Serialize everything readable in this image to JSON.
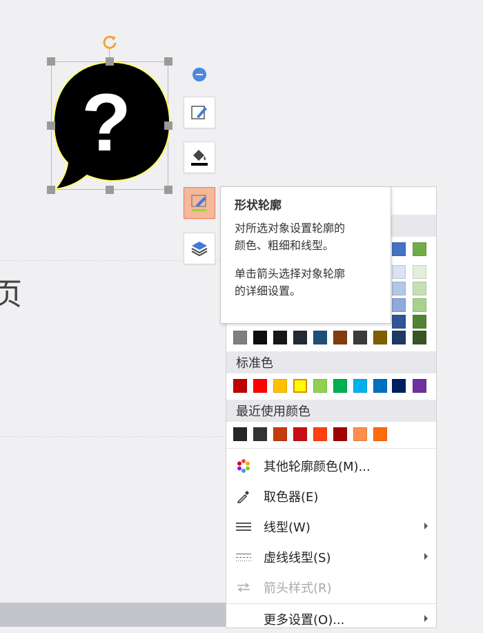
{
  "tooltip": {
    "title": "形状轮廓",
    "line1": "对所选对象设置轮廓的",
    "line2": "颜色、粗细和线型。",
    "line3": "单击箭头选择对象轮廓",
    "line4": "的详细设置。"
  },
  "slide": {
    "partial_text": "页"
  },
  "shape": {
    "glyph": "?"
  },
  "side_buttons": [
    {
      "name": "edit-shape",
      "icon": "pencil-square-icon"
    },
    {
      "name": "fill",
      "icon": "paint-bucket-icon"
    },
    {
      "name": "outline",
      "icon": "pen-outline-icon"
    },
    {
      "name": "layers",
      "icon": "layers-icon"
    }
  ],
  "outline_menu": {
    "theme_colors": {
      "top_row_partial": [
        "#4472c4",
        "#70ad47"
      ],
      "tint_rows_partial": [
        [
          "#dae3f3",
          "#e2efda"
        ],
        [
          "#b4c7e7",
          "#c5e0b4"
        ],
        [
          "#8faadc",
          "#a9d18e"
        ],
        [
          "#2f5597",
          "#548235"
        ]
      ],
      "dark_row": [
        "#7f7f7f",
        "#0d0d0d",
        "#161616",
        "#222a35",
        "#1f4e79",
        "#843c0c",
        "#3b3b3b",
        "#7f6000",
        "#1f3864",
        "#375623"
      ],
      "dark_row_top": [
        "#a5a5a5",
        "#262626",
        "#3a3a3a",
        "#333f50",
        "#2e75b6",
        "#c55a11",
        "#595959",
        "#bf9000",
        "#2f5597",
        "#548235"
      ]
    },
    "standard_label": "标准色",
    "standard_colors": [
      "#c00000",
      "#ff0000",
      "#ffc000",
      "#ffff00",
      "#92d050",
      "#00b050",
      "#00b0f0",
      "#0070c0",
      "#002060",
      "#7030a0"
    ],
    "recent_label": "最近使用颜色",
    "recent_colors": [
      "#262626",
      "#333333",
      "#c43b0d",
      "#c80f13",
      "#ff4114",
      "#a30000",
      "#ff8e4a",
      "#ff6b0d"
    ],
    "items": [
      {
        "label": "其他轮廓颜色(M)...",
        "icon": "color-wheel-icon",
        "submenu": false,
        "disabled": false
      },
      {
        "label": "取色器(E)",
        "icon": "eyedropper-icon",
        "submenu": false,
        "disabled": false
      },
      {
        "label": "线型(W)",
        "icon": "line-weight-icon",
        "submenu": true,
        "disabled": false
      },
      {
        "label": "虚线线型(S)",
        "icon": "dash-line-icon",
        "submenu": true,
        "disabled": false
      },
      {
        "label": "箭头样式(R)",
        "icon": "arrow-style-icon",
        "submenu": false,
        "disabled": true
      },
      {
        "label": "更多设置(O)...",
        "icon": "",
        "submenu": true,
        "disabled": false
      }
    ]
  },
  "colors": {
    "accent_orange": "#ec7e55",
    "rotate_handle": "#f2a23c",
    "shape_fill": "#000000",
    "shape_outline": "#ffff66"
  }
}
